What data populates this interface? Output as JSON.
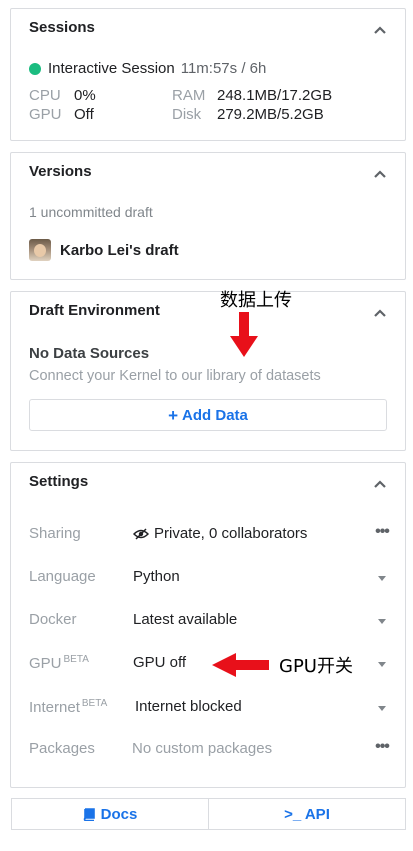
{
  "sessions": {
    "title": "Sessions",
    "session_name": "Interactive Session",
    "timer": "11m:57s / 6h",
    "cpu_label": "CPU",
    "cpu_value": "0%",
    "gpu_label": "GPU",
    "gpu_value": "Off",
    "ram_label": "RAM",
    "ram_value": "248.1MB/17.2GB",
    "disk_label": "Disk",
    "disk_value": "279.2MB/5.2GB"
  },
  "versions": {
    "title": "Versions",
    "uncommitted": "1 uncommitted draft",
    "draft_name": "Karbo Lei's draft"
  },
  "draft_env": {
    "title": "Draft Environment",
    "no_data": "No Data Sources",
    "connect": "Connect your Kernel to our library of datasets",
    "add_plus": "+",
    "add_label": "Add Data"
  },
  "settings": {
    "title": "Settings",
    "beta_tag": "BETA",
    "rows": [
      {
        "label": "Sharing",
        "value": "Private, 0 collaborators",
        "control": "more"
      },
      {
        "label": "Language",
        "value": "Python",
        "control": "dropdown"
      },
      {
        "label": "Docker",
        "value": "Latest available",
        "control": "dropdown"
      },
      {
        "label": "GPU",
        "value": "GPU off",
        "control": "dropdown"
      },
      {
        "label": "Internet",
        "value": "Internet blocked",
        "control": "dropdown"
      },
      {
        "label": "Packages",
        "value": "No custom packages",
        "control": "more"
      }
    ]
  },
  "footer": {
    "docs": "Docs",
    "api": ">_ API"
  },
  "annotations": {
    "upload": "数据上传",
    "gpu_switch": "GPU开关"
  },
  "colors": {
    "accent": "#1a73e8",
    "status_green": "#1bbc80",
    "annotation_red": "#e8101a"
  }
}
